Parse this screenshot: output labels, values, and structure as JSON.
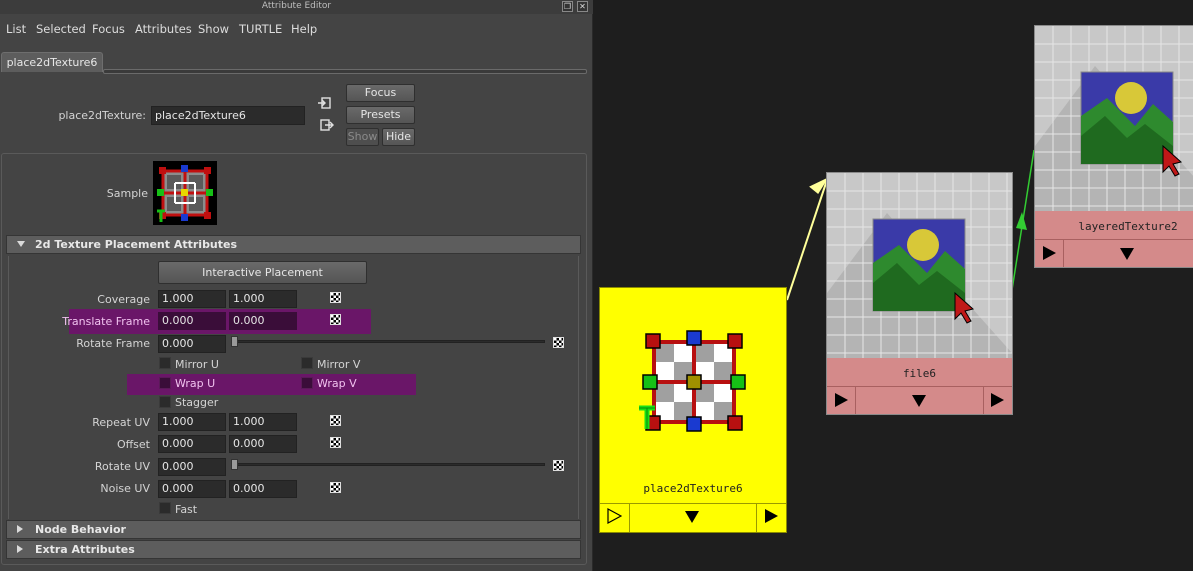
{
  "window": {
    "title": "Attribute Editor"
  },
  "menu": [
    "List",
    "Selected",
    "Focus",
    "Attributes",
    "Show",
    "TURTLE",
    "Help"
  ],
  "tab": {
    "label": "place2dTexture6"
  },
  "node": {
    "type_label": "place2dTexture:",
    "name_value": "place2dTexture6"
  },
  "buttons": {
    "focus": "Focus",
    "presets": "Presets",
    "show": "Show",
    "hide": "Hide"
  },
  "sample_label": "Sample",
  "sections": {
    "placement": "2d Texture Placement Attributes",
    "node_behavior": "Node Behavior",
    "extra": "Extra Attributes"
  },
  "interactive_placement": "Interactive Placement",
  "attrs": {
    "coverage": {
      "label": "Coverage",
      "u": "1.000",
      "v": "1.000"
    },
    "translate_frame": {
      "label": "Translate Frame",
      "u": "0.000",
      "v": "0.000"
    },
    "rotate_frame": {
      "label": "Rotate Frame",
      "value": "0.000"
    },
    "mirror_u": "Mirror U",
    "mirror_v": "Mirror V",
    "wrap_u": "Wrap U",
    "wrap_v": "Wrap V",
    "stagger": "Stagger",
    "repeat_uv": {
      "label": "Repeat UV",
      "u": "1.000",
      "v": "1.000"
    },
    "offset": {
      "label": "Offset",
      "u": "0.000",
      "v": "0.000"
    },
    "rotate_uv": {
      "label": "Rotate UV",
      "value": "0.000"
    },
    "noise_uv": {
      "label": "Noise UV",
      "u": "0.000",
      "v": "0.000"
    },
    "fast": "Fast"
  },
  "graph": {
    "place_node": "place2dTexture6",
    "file_node": "file6",
    "layered_node": "layeredTexture2"
  },
  "colors": {
    "place_node": "#ffff00",
    "texture_node": "#d48a8a",
    "highlight": "#6a1668",
    "connection_yellow": "#ffff9a",
    "connection_green": "#33cc33"
  }
}
